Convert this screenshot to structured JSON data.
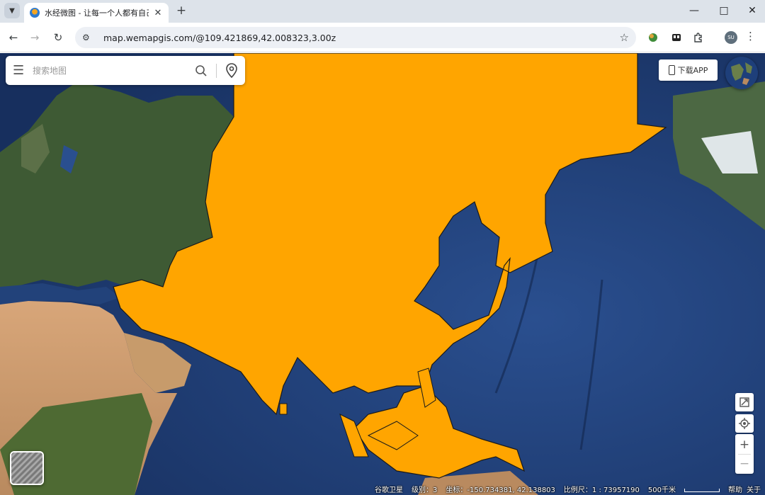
{
  "browser": {
    "tab_title": "水经微图 - 让每一个人都有自己",
    "url": "map.wemapgis.com/@109.421869,42.008323,3.00z",
    "avatar_initials": "SU"
  },
  "map": {
    "search_placeholder": "搜索地图",
    "download_label": "下载APP",
    "highlight_color": "#FFA500",
    "highlighted_region": "Asia",
    "status": {
      "source": "谷歌卫星",
      "level_label": "级别：",
      "level_value": "3",
      "coord_label": "坐标：",
      "coord_value": "-150.734381, 42.138803",
      "scale_label": "比例尺：",
      "scale_value": "1 : 73957190",
      "scale_distance": "500千米",
      "help": "帮助",
      "about": "关于"
    },
    "controls": {
      "zoom_in": "+",
      "zoom_out": "−"
    }
  }
}
